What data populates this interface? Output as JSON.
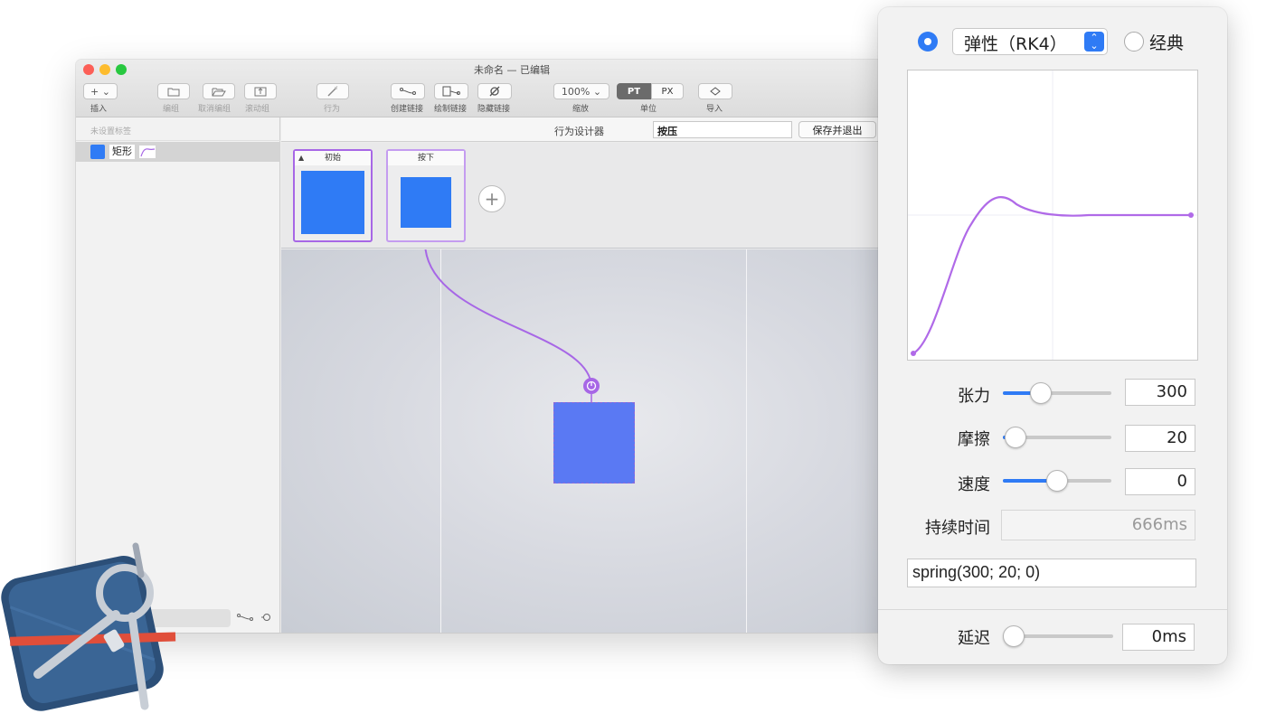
{
  "window": {
    "title": "未命名 — 已编辑",
    "toolbar": {
      "insert_label": "插入",
      "insert_button": "+ ⌄",
      "group_label": "编组",
      "ungroup_label": "取消编组",
      "scroll_group_label": "滚动组",
      "behavior_label": "行为",
      "create_link_label": "创建链接",
      "draw_link_label": "绘制链接",
      "hide_link_label": "隐藏链接",
      "zoom_value": "100% ⌄",
      "zoom_label": "缩放",
      "unit_pt": "PT",
      "unit_px": "PX",
      "unit_label": "单位",
      "import_label": "导入"
    },
    "sidebar": {
      "header": "未设置标签",
      "layer_name": "矩形"
    },
    "behavior_bar": {
      "title": "行为设计器",
      "name_value": "按压",
      "save_exit": "保存并退出"
    },
    "states": [
      {
        "label": "初始"
      },
      {
        "label": "按下"
      }
    ]
  },
  "popover": {
    "mode_selected": "spring",
    "curve_option": "弹性（RK4）",
    "classic_label": "经典",
    "tension": {
      "label": "张力",
      "value": "300",
      "level": 0.35
    },
    "friction": {
      "label": "摩擦",
      "value": "20",
      "level": 0.12
    },
    "velocity": {
      "label": "速度",
      "value": "0",
      "level": 0.5
    },
    "duration": {
      "label": "持续时间",
      "value": "666ms"
    },
    "expression": "spring(300; 20; 0)",
    "delay": {
      "label": "延迟",
      "value": "0ms",
      "level": 0.0
    }
  },
  "colors": {
    "accent": "#2f7bf5",
    "link_purple": "#a767e6",
    "layer_blue": "#5a79f3"
  }
}
